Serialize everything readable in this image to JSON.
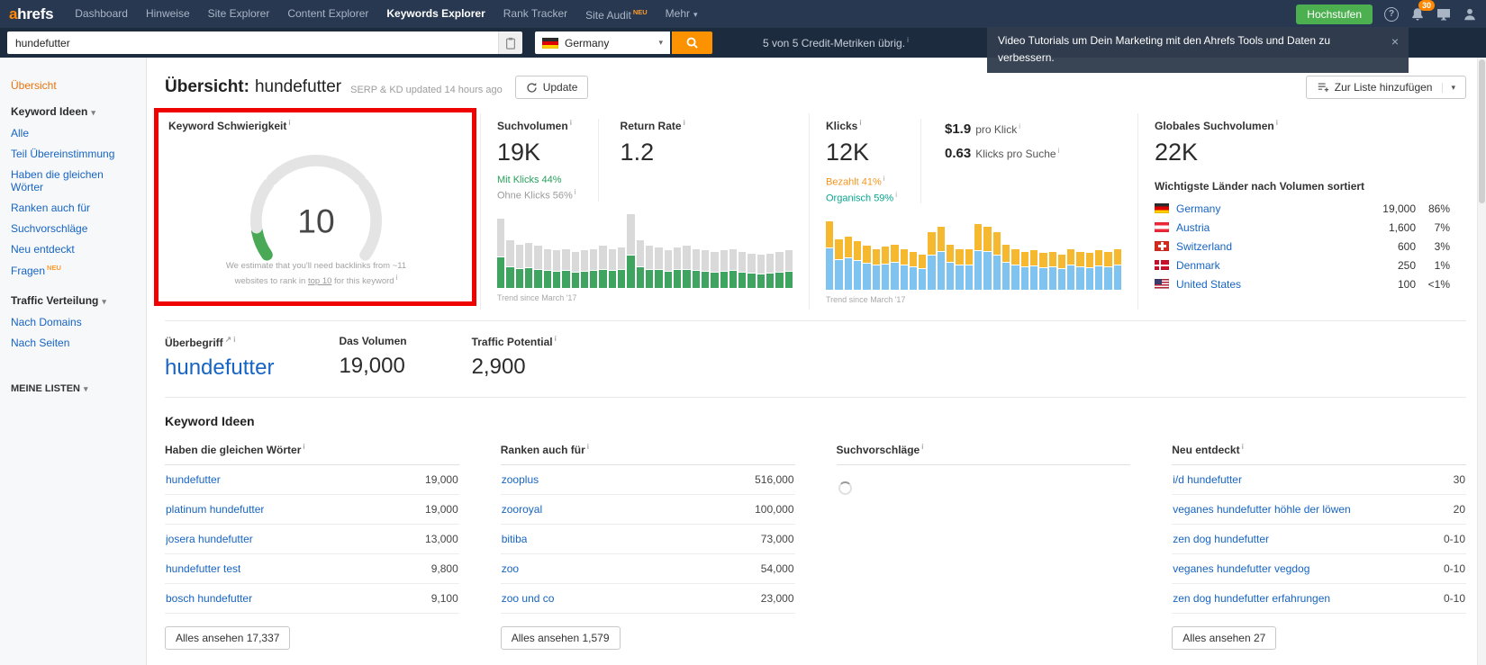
{
  "colors": {
    "brand_orange": "#ff8800",
    "upgrade_green": "#4caf50",
    "link_blue": "#1664c4",
    "highlight_red": "#ee0202",
    "gauge_green": "#4aa957"
  },
  "topnav": {
    "logo_a": "a",
    "logo_rest": "hrefs",
    "items": [
      {
        "label": "Dashboard",
        "active": false
      },
      {
        "label": "Hinweise",
        "active": false
      },
      {
        "label": "Site Explorer",
        "active": false
      },
      {
        "label": "Content Explorer",
        "active": false
      },
      {
        "label": "Keywords Explorer",
        "active": true
      },
      {
        "label": "Rank Tracker",
        "active": false
      },
      {
        "label": "Site Audit",
        "active": false,
        "badge": "NEU"
      },
      {
        "label": "Mehr",
        "active": false,
        "caret": true
      }
    ],
    "upgrade_label": "Hochstufen",
    "bell_badge": "30"
  },
  "searchbar": {
    "query": "hundefutter",
    "country": "Germany",
    "credits_text": "5 von 5 Credit-Metriken übrig.",
    "toast_text": "Video Tutorials um Dein Marketing mit den Ahrefs Tools und Daten zu verbessern."
  },
  "sidebar": {
    "overview": "Übersicht",
    "groups": [
      {
        "title": "Keyword Ideen",
        "items": [
          {
            "label": "Alle"
          },
          {
            "label": "Teil Übereinstimmung"
          },
          {
            "label": "Haben die gleichen Wörter"
          },
          {
            "label": "Ranken auch für"
          },
          {
            "label": "Suchvorschläge"
          },
          {
            "label": "Neu entdeckt"
          },
          {
            "label": "Fragen",
            "badge": "NEU"
          }
        ]
      },
      {
        "title": "Traffic Verteilung",
        "items": [
          {
            "label": "Nach Domains"
          },
          {
            "label": "Nach Seiten"
          }
        ]
      }
    ],
    "lists_title": "MEINE LISTEN"
  },
  "header": {
    "title_prefix": "Übersicht:",
    "keyword": "hundefutter",
    "updated_text": "SERP & KD updated 14 hours ago",
    "update_button": "Update",
    "add_to_list_button": "Zur Liste hinzufügen"
  },
  "overview": {
    "kd": {
      "title": "Keyword Schwierigkeit",
      "value": "10",
      "note_before": "We estimate that you'll need backlinks from ~11 websites to rank in ",
      "note_link": "top 10",
      "note_after": " for this keyword"
    },
    "volume": {
      "title": "Suchvolumen",
      "value": "19K",
      "return_rate_title": "Return Rate",
      "return_rate_value": "1.2",
      "clicks_pct": "Mit Klicks 44%",
      "no_clicks_pct": "Ohne Klicks 56%",
      "trend_caption": "Trend since March '17"
    },
    "clicks": {
      "title": "Klicks",
      "value": "12K",
      "cpc_value": "$1.9",
      "cpc_label": "pro Klick",
      "cps_value": "0.63",
      "cps_label": "Klicks pro Suche",
      "paid": "Bezahlt 41%",
      "organic": "Organisch 59%",
      "trend_caption": "Trend since March '17"
    },
    "global": {
      "title": "Globales Suchvolumen",
      "value": "22K",
      "subtitle": "Wichtigste Länder nach Volumen sortiert",
      "countries": [
        {
          "flag": "de",
          "name": "Germany",
          "volume": "19,000",
          "share": "86%"
        },
        {
          "flag": "at",
          "name": "Austria",
          "volume": "1,600",
          "share": "7%"
        },
        {
          "flag": "ch",
          "name": "Switzerland",
          "volume": "600",
          "share": "3%"
        },
        {
          "flag": "dk",
          "name": "Denmark",
          "volume": "250",
          "share": "1%"
        },
        {
          "flag": "us",
          "name": "United States",
          "volume": "100",
          "share": "<1%"
        }
      ]
    }
  },
  "parent": {
    "label": "Überbegriff",
    "keyword": "hundefutter",
    "volume_label": "Das Volumen",
    "volume_value": "19,000",
    "tp_label": "Traffic Potential",
    "tp_value": "2,900"
  },
  "ideas": {
    "heading": "Keyword Ideen",
    "columns": [
      {
        "title": "Haben die gleichen Wörter",
        "rows": [
          [
            "hundefutter",
            "19,000"
          ],
          [
            "platinum hundefutter",
            "19,000"
          ],
          [
            "josera hundefutter",
            "13,000"
          ],
          [
            "hundefutter test",
            "9,800"
          ],
          [
            "bosch hundefutter",
            "9,100"
          ]
        ],
        "button": "Alles ansehen 17,337"
      },
      {
        "title": "Ranken auch für",
        "rows": [
          [
            "zooplus",
            "516,000"
          ],
          [
            "zooroyal",
            "100,000"
          ],
          [
            "bitiba",
            "73,000"
          ],
          [
            "zoo",
            "54,000"
          ],
          [
            "zoo und co",
            "23,000"
          ]
        ],
        "button": "Alles ansehen 1,579"
      },
      {
        "title": "Suchvorschläge",
        "loading": true
      },
      {
        "title": "Neu entdeckt",
        "rows": [
          [
            "i/d hundefutter",
            "30"
          ],
          [
            "veganes hundefutter höhle der löwen",
            "20"
          ],
          [
            "zen dog hundefutter",
            "0-10"
          ],
          [
            "veganes hundefutter vegdog",
            "0-10"
          ],
          [
            "zen dog hundefutter erfahrungen",
            "0-10"
          ]
        ],
        "button": "Alles ansehen 27"
      }
    ]
  },
  "chart_data": [
    {
      "id": "volume-trend",
      "type": "stacked-bar",
      "title": "Suchvolumen Trend",
      "caption": "Trend since March '17",
      "x": "months since March 2017",
      "unit": "percent of chart height",
      "series": [
        {
          "name": "Mit Klicks",
          "color": "#3fa45f",
          "values": [
            40,
            27,
            25,
            26,
            24,
            22,
            21,
            22,
            20,
            21,
            22,
            24,
            22,
            23,
            42,
            27,
            24,
            23,
            21,
            23,
            24,
            22,
            21,
            20,
            21,
            22,
            20,
            19,
            18,
            19,
            20,
            21
          ]
        },
        {
          "name": "Ohne Klicks",
          "color": "#d9d9d9",
          "values": [
            50,
            35,
            31,
            32,
            30,
            28,
            27,
            28,
            26,
            27,
            28,
            30,
            28,
            29,
            54,
            35,
            30,
            29,
            27,
            29,
            30,
            28,
            27,
            26,
            27,
            28,
            26,
            25,
            24,
            25,
            26,
            27
          ]
        }
      ]
    },
    {
      "id": "clicks-trend",
      "type": "stacked-bar",
      "title": "Klicks Trend",
      "caption": "Trend since March '17",
      "x": "months since March 2017",
      "unit": "percent of chart height",
      "series": [
        {
          "name": "Organisch",
          "color": "#7fc4f0",
          "values": [
            55,
            40,
            42,
            38,
            35,
            32,
            34,
            36,
            32,
            30,
            28,
            46,
            50,
            36,
            32,
            32,
            52,
            50,
            46,
            36,
            32,
            30,
            31,
            29,
            30,
            28,
            32,
            30,
            29,
            31,
            30,
            32
          ]
        },
        {
          "name": "Bezahlt",
          "color": "#f5b82e",
          "values": [
            35,
            26,
            27,
            25,
            23,
            21,
            22,
            23,
            21,
            19,
            18,
            30,
            32,
            23,
            21,
            21,
            34,
            32,
            30,
            23,
            21,
            19,
            20,
            19,
            19,
            18,
            21,
            19,
            19,
            20,
            19,
            21
          ]
        }
      ]
    }
  ]
}
